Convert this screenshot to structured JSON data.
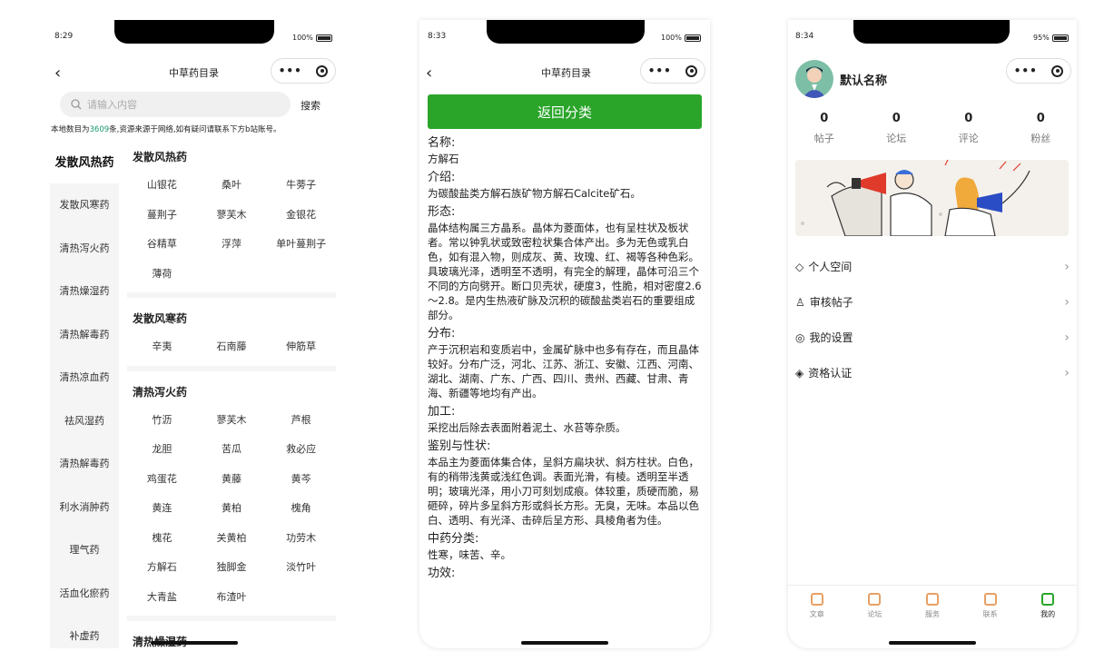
{
  "phone1": {
    "time": "8:29",
    "battery": "100%",
    "title": "中草药目录",
    "search": {
      "placeholder": "请输入内容",
      "button": "搜索"
    },
    "notice_prefix": "本地数目为",
    "notice_count": "3609",
    "notice_suffix": "条,资源来源于网络,如有疑问请联系下方b站账号。",
    "sidebar": [
      "发散风热药",
      "发散风寒药",
      "清热泻火药",
      "清热燥湿药",
      "清热解毒药",
      "清热凉血药",
      "祛风湿药",
      "清热解毒药",
      "利水消肿药",
      "理气药",
      "活血化瘀药",
      "补虚药"
    ],
    "groups": [
      {
        "title": "发散风热药",
        "items": [
          "山银花",
          "桑叶",
          "牛蒡子",
          "蔓荆子",
          "蓼芙木",
          "金银花",
          "谷精草",
          "浮萍",
          "单叶蔓荆子",
          "薄荷"
        ]
      },
      {
        "title": "发散风寒药",
        "items": [
          "辛夷",
          "石南藤",
          "伸筋草"
        ]
      },
      {
        "title": "清热泻火药",
        "items": [
          "竹沥",
          "蓼芙木",
          "芦根",
          "龙胆",
          "苦瓜",
          "救必应",
          "鸡蛋花",
          "黄藤",
          "黄芩",
          "黄连",
          "黄柏",
          "槐角",
          "槐花",
          "关黄柏",
          "功劳木",
          "方解石",
          "独脚金",
          "淡竹叶",
          "大青盐",
          "布渣叶"
        ]
      },
      {
        "title": "清热燥湿药",
        "items": []
      }
    ]
  },
  "phone2": {
    "time": "8:33",
    "battery": "100%",
    "title": "中草药目录",
    "return_button": "返回分类",
    "sections": [
      {
        "title": "名称:",
        "body": "方解石"
      },
      {
        "title": "介绍:",
        "body": "为碳酸盐类方解石族矿物方解石Calcite矿石。"
      },
      {
        "title": "形态:",
        "body": "晶体结构属三方晶系。晶体为菱面体，也有呈柱状及板状者。常以钟乳状或致密粒状集合体产出。多为无色或乳白色，如有混入物，则成灰、黄、玫瑰、红、褐等各种色彩。具玻璃光泽，透明至不透明，有完全的解理，晶体可沿三个不同的方向劈开。断口贝壳状，硬度3，性脆，相对密度2.6～2.8。是内生热液矿脉及沉积的碳酸盐类岩石的重要组成部分。"
      },
      {
        "title": "分布:",
        "body": "产于沉积岩和变质岩中，金属矿脉中也多有存在，而且晶体较好。分布广泛，河北、江苏、浙江、安徽、江西、河南、湖北、湖南、广东、广西、四川、贵州、西藏、甘肃、青海、新疆等地均有产出。"
      },
      {
        "title": "加工:",
        "body": "采挖出后除去表面附着泥土、水苔等杂质。"
      },
      {
        "title": "鉴别与性状:",
        "body": "本品主为菱面体集合体，呈斜方扁块状、斜方柱状。白色，有的稍带浅黄或浅红色调。表面光滑，有棱。透明至半透明；玻璃光泽，用小刀可刻划成痕。体较重，质硬而脆，易砸碎，碎片多呈斜方形或斜长方形。无臭，无味。本品以色白、透明、有光泽、击碎后呈方形、具棱角者为佳。"
      },
      {
        "title": "中药分类:",
        "body": "性寒，味苦、辛。"
      },
      {
        "title": "功效:",
        "body": ""
      }
    ]
  },
  "phone3": {
    "time": "8:34",
    "battery": "95%",
    "username": "默认名称",
    "stats": [
      {
        "value": "0",
        "label": "帖子"
      },
      {
        "value": "0",
        "label": "论坛"
      },
      {
        "value": "0",
        "label": "评论"
      },
      {
        "value": "0",
        "label": "粉丝"
      }
    ],
    "menu": [
      {
        "icon": "◇",
        "label": "个人空间"
      },
      {
        "icon": "♙",
        "label": "审核帖子"
      },
      {
        "icon": "◎",
        "label": "我的设置"
      },
      {
        "icon": "◈",
        "label": "资格认证"
      }
    ],
    "tabs": [
      "文章",
      "论坛",
      "服务",
      "联系",
      "我的"
    ]
  }
}
